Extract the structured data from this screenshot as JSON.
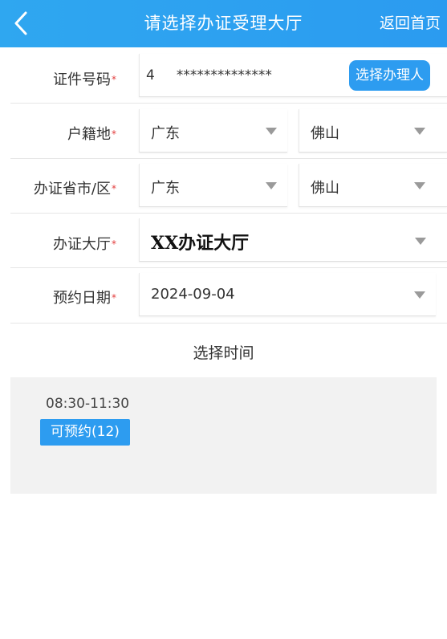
{
  "header": {
    "title": "请选择办证受理大厅",
    "home_label": "返回首页"
  },
  "form": {
    "id_number": {
      "label": "证件号码",
      "value": "4     **************",
      "pick_button": "选择办理人"
    },
    "residence": {
      "label": "户籍地",
      "province": "广东",
      "city": "佛山"
    },
    "office_region": {
      "label": "办证省市/区",
      "province": "广东",
      "city": "佛山"
    },
    "hall": {
      "label": "办证大厅",
      "value": "XX办证大厅"
    },
    "date": {
      "label": "预约日期",
      "value": "2024-09-04"
    },
    "required_mark": "*"
  },
  "time_selection": {
    "title": "选择时间",
    "slots": [
      {
        "time": "08:30-11:30",
        "status": "可预约(12)"
      }
    ]
  },
  "colors": {
    "accent": "#2d9cf0",
    "required": "#e23c3c"
  }
}
